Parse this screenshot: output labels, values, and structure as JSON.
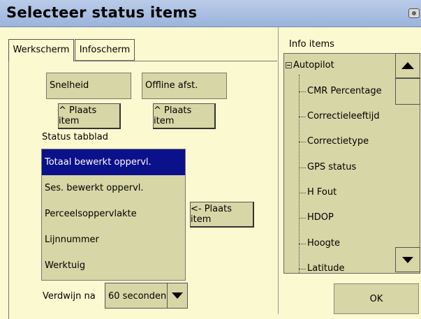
{
  "window": {
    "title": "Selecteer status items",
    "title_bar_color": "#a9bfe2",
    "background_color": "#fbf9cf"
  },
  "tabs": [
    {
      "label": "Werkscherm",
      "active": true
    },
    {
      "label": "Infoscherm",
      "active": false
    }
  ],
  "slots": [
    {
      "value": "Snelheid",
      "button_label": "^ Plaats item"
    },
    {
      "value": "Offline afst.",
      "button_label": "^ Plaats item"
    }
  ],
  "status_tab": {
    "label": "Status tabblad",
    "items": [
      "Totaal bewerkt oppervl.",
      "Ses. bewerkt oppervl.",
      "Perceelsoppervlakte",
      "Lijnnummer",
      "Werktuig"
    ],
    "selected_index": 0,
    "selected_color": "#0b118a",
    "place_button_label": "<- Plaats item"
  },
  "hide_after": {
    "label": "Verdwijn na",
    "value": "60 seconden"
  },
  "info_items": {
    "label": "Info items",
    "root": "Autopilot",
    "children": [
      "CMR Percentage",
      "Correctieleeftijd",
      "Correctietype",
      "GPS status",
      "H Fout",
      "HDOP",
      "Hoogte",
      "Latitude"
    ]
  },
  "ok_label": "OK",
  "icons": {
    "title_right": "camera-icon",
    "scroll_up": "arrow-up-icon",
    "scroll_down": "arrow-down-icon",
    "dropdown": "chevron-down-icon",
    "tree_toggle": "collapse-icon"
  }
}
